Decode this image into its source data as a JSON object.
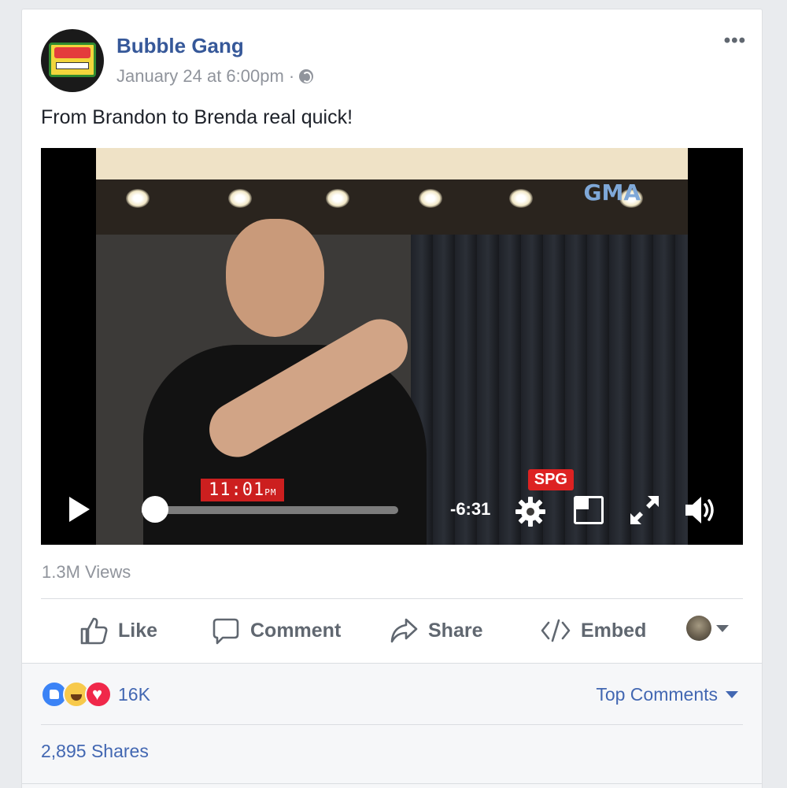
{
  "post": {
    "page_name": "Bubble Gang",
    "timestamp": "January 24 at 6:00pm",
    "separator": "·",
    "more_label": "•••",
    "text": "From Brandon to Brenda real quick!",
    "avatar_icon": "bubble-gang-logo"
  },
  "video": {
    "time_remaining": "-6:31",
    "progress": 0.02,
    "overlay_clock": "11:01",
    "overlay_clock_suffix": "PM",
    "channel_watermark": "GMA",
    "rating_badge": "SPG",
    "controls": [
      "play-icon",
      "progress-bar",
      "settings-gear-icon",
      "picture-in-picture-icon",
      "fullscreen-icon",
      "volume-icon"
    ]
  },
  "stats": {
    "views": "1.3M Views",
    "reaction_count": "16K",
    "reactions": [
      "like",
      "haha",
      "love"
    ],
    "shares": "2,895 Shares",
    "sort_label": "Top Comments"
  },
  "actions": {
    "like": "Like",
    "comment": "Comment",
    "share": "Share",
    "embed": "Embed"
  },
  "colors": {
    "link_blue": "#365899",
    "action_gray": "#606770",
    "meta_gray": "#90949c",
    "reaction_blue": "#4267b2"
  }
}
